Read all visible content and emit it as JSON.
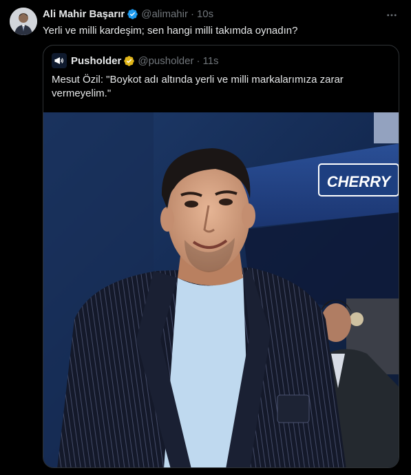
{
  "tweet": {
    "author_name": "Ali Mahir Başarır",
    "handle": "@alimahir",
    "separator": "·",
    "time": "10s",
    "text": "Yerli ve milli kardeşim; sen hangi milli takımda oynadın?"
  },
  "quoted": {
    "author_name": "Pusholder",
    "handle": "@pusholder",
    "separator": "·",
    "time": "11s",
    "text": "Mesut Özil: \"Boykot adı altında yerli ve milli markalarımıza zarar vermeyelim.\"",
    "image_sign_text": "CHERRY"
  },
  "colors": {
    "background": "#000000",
    "text_primary": "#e7e9ea",
    "text_secondary": "#71767b",
    "verified_blue": "#1d9bf0",
    "verified_gold": "#e2b719",
    "border": "#2f3336"
  },
  "icons": {
    "verified_blue": "verified-badge-icon",
    "verified_gold": "gold-verified-badge-icon",
    "more": "more-options-icon"
  }
}
